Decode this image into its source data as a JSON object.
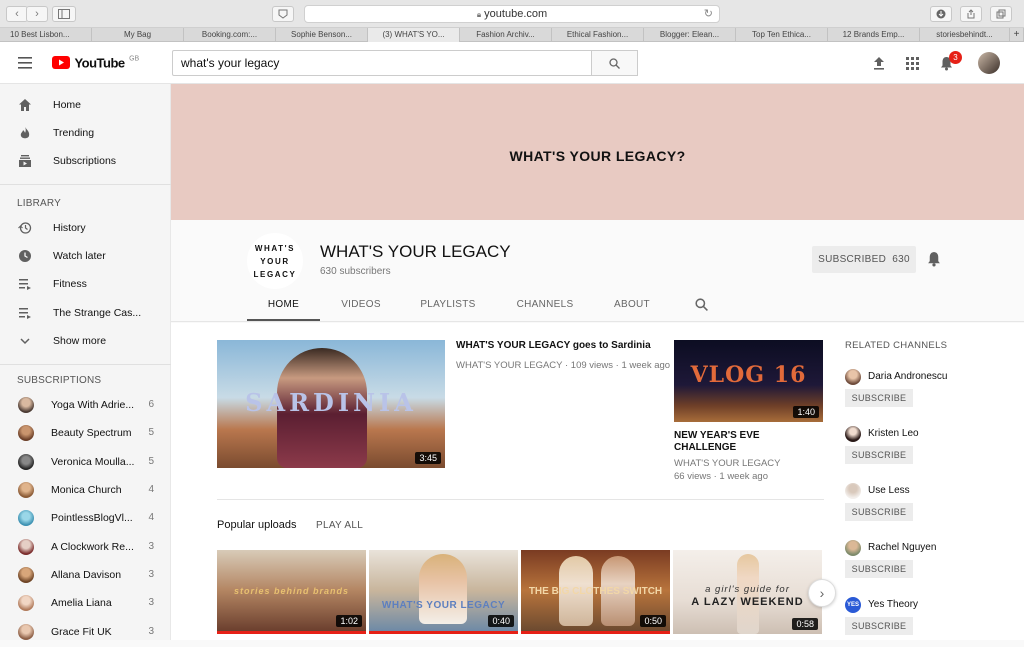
{
  "browser": {
    "url": "youtube.com",
    "tabs": [
      "10 Best Lisbon...",
      "My Bag",
      "Booking.com:...",
      "Sophie Benson...",
      "(3) WHAT'S YO...",
      "Fashion Archiv...",
      "Ethical Fashion...",
      "Blogger: Elean...",
      "Top Ten Ethica...",
      "12 Brands Emp...",
      "storiesbehindt..."
    ]
  },
  "header": {
    "logo_text": "YouTube",
    "logo_sup": "GB",
    "search_value": "what's your legacy",
    "notification_count": "3"
  },
  "sidebar": {
    "main": [
      {
        "label": "Home"
      },
      {
        "label": "Trending"
      },
      {
        "label": "Subscriptions"
      }
    ],
    "library_heading": "LIBRARY",
    "library": [
      {
        "label": "History"
      },
      {
        "label": "Watch later"
      },
      {
        "label": "Fitness"
      },
      {
        "label": "The Strange Cas..."
      },
      {
        "label": "Show more"
      }
    ],
    "subscriptions_heading": "SUBSCRIPTIONS",
    "subscriptions": [
      {
        "label": "Yoga With Adrie...",
        "count": "6"
      },
      {
        "label": "Beauty Spectrum",
        "count": "5"
      },
      {
        "label": "Veronica Moulla...",
        "count": "5"
      },
      {
        "label": "Monica Church",
        "count": "4"
      },
      {
        "label": "PointlessBlogVl...",
        "count": "4"
      },
      {
        "label": "A Clockwork Re...",
        "count": "3"
      },
      {
        "label": "Allana Davison",
        "count": "3"
      },
      {
        "label": "Amelia Liana",
        "count": "3"
      },
      {
        "label": "Grace Fit UK",
        "count": "3"
      }
    ]
  },
  "banner": {
    "text": "WHAT'S YOUR LEGACY?"
  },
  "channel": {
    "avatar_line1": "WHAT'S",
    "avatar_line2": "YOUR",
    "avatar_line3": "LEGACY",
    "name": "WHAT'S YOUR LEGACY",
    "subscribers": "630 subscribers",
    "subscribe_label": "SUBSCRIBED",
    "subscribe_count": "630",
    "tabs": [
      "HOME",
      "VIDEOS",
      "PLAYLISTS",
      "CHANNELS",
      "ABOUT"
    ]
  },
  "featured": {
    "thumb_text": "SARDINIA",
    "duration": "3:45",
    "title": "WHAT'S YOUR LEGACY goes to Sardinia",
    "meta": "WHAT'S YOUR LEGACY · 109 views · 1 week ago"
  },
  "vlog": {
    "thumb_text": "VLOG 16",
    "duration": "1:40",
    "title_line1": "NEW YEAR'S EVE",
    "title_line2": "CHALLENGE",
    "channel": "WHAT'S YOUR LEGACY",
    "meta": "66 views · 1 week ago"
  },
  "popular": {
    "heading": "Popular uploads",
    "play_all": "PLAY ALL",
    "videos": [
      {
        "overlay": "stories behind brands",
        "duration": "1:02"
      },
      {
        "overlay": "WHAT'S YOUR LEGACY",
        "duration": "0:40"
      },
      {
        "overlay": "THE BIG CLOTHES SWITCH",
        "duration": "0:50"
      },
      {
        "overlay1": "a girl's guide for",
        "overlay2": "A LAZY WEEKEND",
        "duration": "0:58"
      }
    ]
  },
  "related": {
    "heading": "RELATED CHANNELS",
    "subscribe_label": "SUBSCRIBE",
    "channels": [
      {
        "name": "Daria Andronescu"
      },
      {
        "name": "Kristen Leo"
      },
      {
        "name": "Use Less"
      },
      {
        "name": "Rachel Nguyen"
      },
      {
        "name": "Yes Theory",
        "avatar_text": "YES"
      }
    ]
  }
}
